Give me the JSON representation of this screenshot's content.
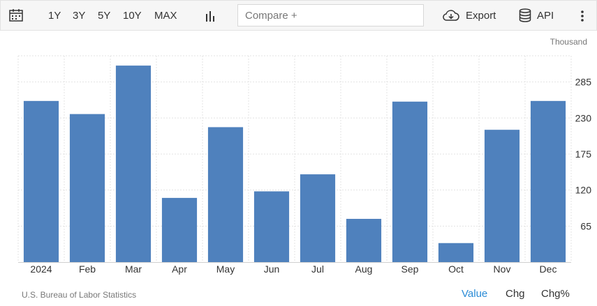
{
  "toolbar": {
    "ranges": [
      "1Y",
      "3Y",
      "5Y",
      "10Y",
      "MAX"
    ],
    "compare_placeholder": "Compare +",
    "export_label": "Export",
    "api_label": "API",
    "icons": [
      "calendar-icon",
      "bar-chart-icon",
      "cloud-download-icon",
      "database-icon",
      "more-vertical-icon"
    ]
  },
  "unit_label": "Thousand",
  "source_label": "U.S. Bureau of Labor Statistics",
  "footer_tabs": [
    "Value",
    "Chg",
    "Chg%"
  ],
  "colors": {
    "bar": "#4f81bd",
    "active_tab": "#2a8bd6"
  },
  "chart_data": {
    "type": "bar",
    "categories": [
      "2024",
      "Feb",
      "Mar",
      "Apr",
      "May",
      "Jun",
      "Jul",
      "Aug",
      "Sep",
      "Oct",
      "Nov",
      "Dec"
    ],
    "values": [
      256,
      236,
      310,
      108,
      216,
      118,
      144,
      76,
      255,
      39,
      212,
      256
    ],
    "yticks": [
      65,
      120,
      175,
      230,
      285
    ],
    "ylim": [
      10,
      325
    ],
    "grid": true,
    "xlabel": "",
    "ylabel": ""
  }
}
